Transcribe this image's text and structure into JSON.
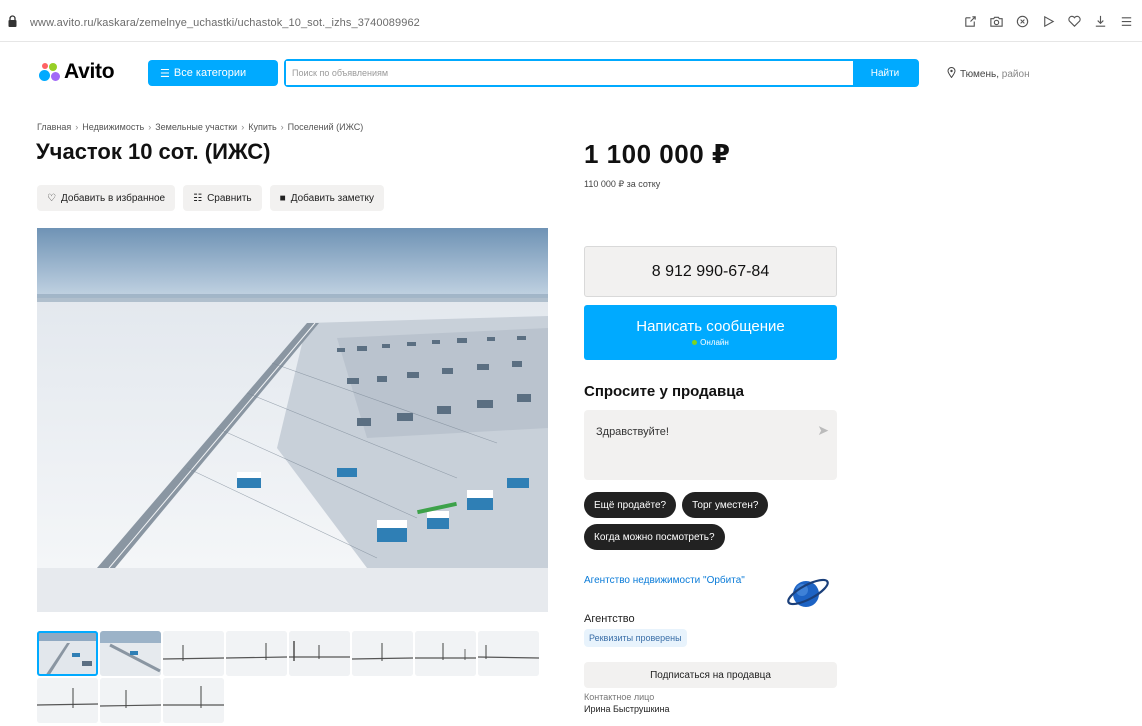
{
  "browser": {
    "url": "www.avito.ru/kaskara/zemelnye_uchastki/uchastok_10_sot._izhs_3740089962",
    "toolbar_icons": [
      "share-icon",
      "camera-icon",
      "extension-icon",
      "play-icon",
      "heart-icon",
      "download-icon",
      "menu-icon"
    ]
  },
  "header": {
    "logo_text": "Avito",
    "categories_label": "Все категории",
    "search_placeholder": "Поиск по объявлениям",
    "search_button": "Найти",
    "location": "Тюмень,",
    "location_sub": "район"
  },
  "breadcrumbs": [
    "Главная",
    "Недвижимость",
    "Земельные участки",
    "Купить",
    "Поселений (ИЖС)"
  ],
  "listing": {
    "title": "Участок 10 сот. (ИЖС)",
    "price": "1 100 000 ₽",
    "price_per_unit": "110 000 ₽ за сотку"
  },
  "actions": {
    "favorite": "Добавить в избранное",
    "compare": "Сравнить",
    "note": "Добавить заметку"
  },
  "gallery": {
    "thumb_count": 11,
    "active_index": 0
  },
  "contact": {
    "phone": "8 912 990-67-84",
    "message_button": "Написать сообщение",
    "online_status": "Онлайн"
  },
  "ask": {
    "title": "Спросите у продавца",
    "draft": "Здравствуйте!",
    "chips": [
      "Ещё продаёте?",
      "Торг уместен?",
      "Когда можно посмотреть?"
    ]
  },
  "seller": {
    "name": "Агентство недвижимости \"Орбита\"",
    "type": "Агентство",
    "verified": "Реквизиты проверены",
    "subscribe": "Подписаться на продавца",
    "contact_label": "Контактное лицо",
    "contact_name": "Ирина Быструшкина"
  },
  "colors": {
    "accent": "#00aaff",
    "link": "#0a7bd8",
    "chip_bg": "#222222",
    "button_gray": "#f2f1f0"
  }
}
